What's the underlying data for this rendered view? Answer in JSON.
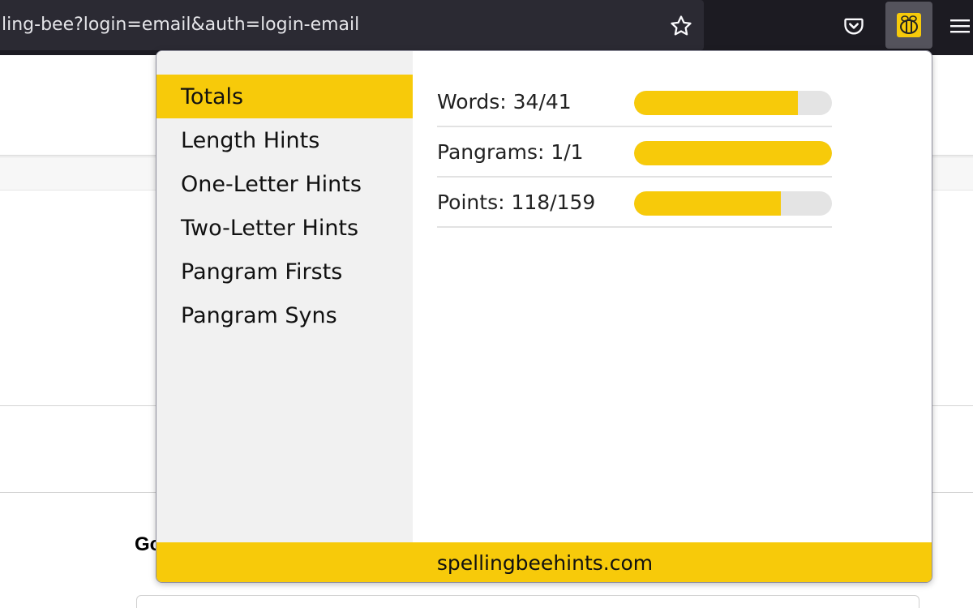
{
  "browser": {
    "url": "ling-bee?login=email&auth=login-email",
    "icons": {
      "bookmark": "star-icon",
      "pocket": "pocket-icon",
      "extension": "bee-icon",
      "menu": "hamburger-menu-icon"
    }
  },
  "background": {
    "heading": "Go"
  },
  "popup": {
    "nav": [
      {
        "label": "Totals",
        "active": true
      },
      {
        "label": "Length Hints",
        "active": false
      },
      {
        "label": "One-Letter Hints",
        "active": false
      },
      {
        "label": "Two-Letter Hints",
        "active": false
      },
      {
        "label": "Pangram Firsts",
        "active": false
      },
      {
        "label": "Pangram Syns",
        "active": false
      }
    ],
    "stats": [
      {
        "label": "Words: 34/41",
        "progress": 0.829
      },
      {
        "label": "Pangrams: 1/1",
        "progress": 1.0
      },
      {
        "label": "Points: 118/159",
        "progress": 0.742
      }
    ],
    "footer": "spellingbeehints.com"
  },
  "colors": {
    "accent": "#f7ca0a",
    "toolbar": "#1c1b22",
    "sidebar": "#f1f1f1",
    "track": "#e4e4e4"
  }
}
